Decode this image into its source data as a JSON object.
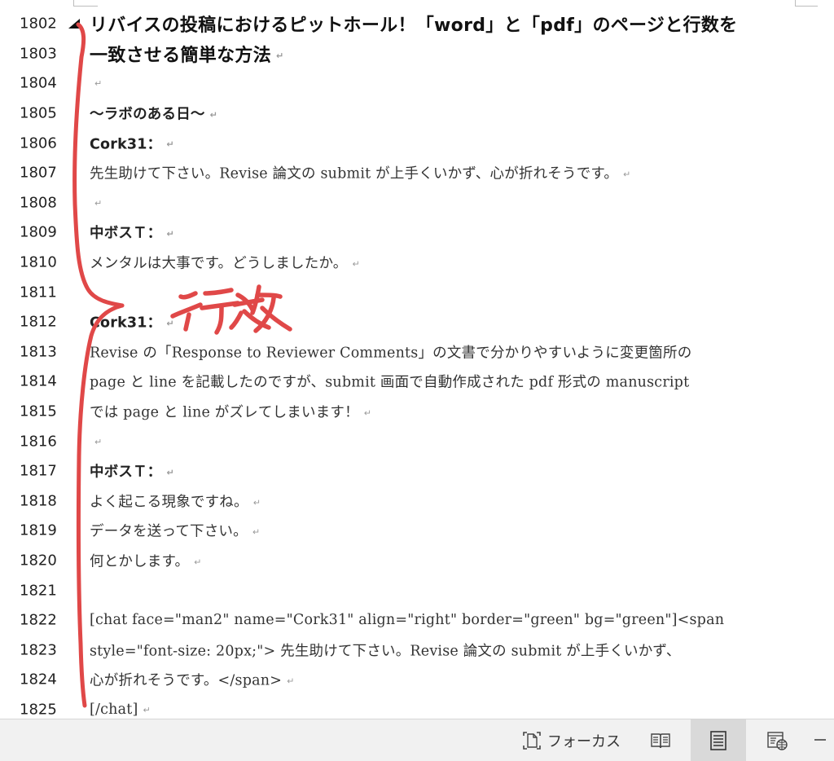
{
  "document": {
    "lines": [
      {
        "num": "1802",
        "style": "heading",
        "text": "リバイスの投稿におけるピットホール！「word」と「pdf」のページと行数を",
        "mark": false
      },
      {
        "num": "1803",
        "style": "heading",
        "text": "一致させる簡単な方法",
        "mark": true
      },
      {
        "num": "1804",
        "style": "normal",
        "text": "",
        "mark": true
      },
      {
        "num": "1805",
        "style": "bold",
        "text": "～ラボのある日～",
        "mark": true
      },
      {
        "num": "1806",
        "style": "bold",
        "text": "Cork31：",
        "mark": true
      },
      {
        "num": "1807",
        "style": "normal",
        "text": "先生助けて下さい。Revise 論文の submit が上手くいかず、心が折れそうです。",
        "mark": true
      },
      {
        "num": "1808",
        "style": "normal",
        "text": "",
        "mark": true
      },
      {
        "num": "1809",
        "style": "bold",
        "text": "中ボスＴ：",
        "mark": true
      },
      {
        "num": "1810",
        "style": "normal",
        "text": "メンタルは大事です。どうしましたか。",
        "mark": true
      },
      {
        "num": "1811",
        "style": "normal",
        "text": "",
        "mark": false
      },
      {
        "num": "1812",
        "style": "bold",
        "text": "Cork31：",
        "mark": true
      },
      {
        "num": "1813",
        "style": "normal",
        "text": "Revise の「Response to Reviewer Comments」の文書で分かりやすいように変更箇所の",
        "mark": false
      },
      {
        "num": "1814",
        "style": "normal",
        "text": "page と line を記載したのですが、submit 画面で自動作成された pdf 形式の manuscript",
        "mark": false
      },
      {
        "num": "1815",
        "style": "normal",
        "text": "では page と line がズレてしまいます！",
        "mark": true
      },
      {
        "num": "1816",
        "style": "normal",
        "text": "",
        "mark": true
      },
      {
        "num": "1817",
        "style": "bold",
        "text": "中ボスＴ：",
        "mark": true
      },
      {
        "num": "1818",
        "style": "normal",
        "text": "よく起こる現象ですね。",
        "mark": true
      },
      {
        "num": "1819",
        "style": "normal",
        "text": "データを送って下さい。",
        "mark": true
      },
      {
        "num": "1820",
        "style": "normal",
        "text": "何とかします。",
        "mark": true
      },
      {
        "num": "1821",
        "style": "normal",
        "text": "",
        "mark": false
      },
      {
        "num": "1822",
        "style": "normal",
        "text": "[chat face=\"man2\" name=\"Cork31\" align=\"right\" border=\"green\" bg=\"green\"]<span",
        "mark": false
      },
      {
        "num": "1823",
        "style": "normal",
        "text": "style=\"font-size: 20px;\"> 先生助けて下さい。Revise 論文の submit が上手くいかず、",
        "mark": false
      },
      {
        "num": "1824",
        "style": "normal",
        "text": "心が折れそうです。</span>",
        "mark": true
      },
      {
        "num": "1825",
        "style": "normal",
        "text": "[/chat]",
        "mark": true
      }
    ],
    "paragraph_mark": "↵",
    "annotation": "行数",
    "ink_color": "#e04848"
  },
  "statusbar": {
    "focus_label": "フォーカス",
    "views": [
      {
        "name": "read-mode-icon",
        "active": false
      },
      {
        "name": "print-layout-icon",
        "active": true
      },
      {
        "name": "web-layout-icon",
        "active": false
      }
    ]
  }
}
